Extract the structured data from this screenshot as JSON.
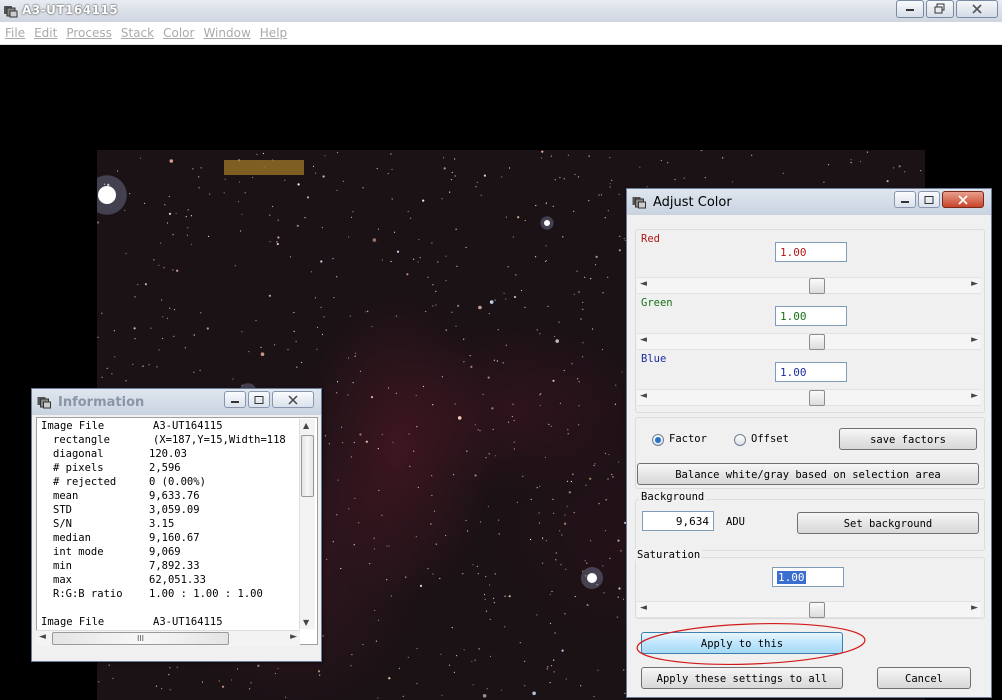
{
  "window": {
    "title": "A3-UT164115"
  },
  "menu": [
    "File",
    "Edit",
    "Process",
    "Stack",
    "Color",
    "Window",
    "Help"
  ],
  "info": {
    "title": "Information",
    "rows": [
      {
        "k": "Image File",
        "v": "A3-UT164115"
      },
      {
        "k": "rectangle",
        "v": "(X=187,Y=15,Width=118"
      },
      {
        "k": "diagonal",
        "v": "120.03"
      },
      {
        "k": "# pixels",
        "v": "2,596"
      },
      {
        "k": "# rejected",
        "v": "0 (0.00%)"
      },
      {
        "k": "mean",
        "v": "9,633.76"
      },
      {
        "k": "STD",
        "v": "3,059.09"
      },
      {
        "k": "S/N",
        "v": "3.15"
      },
      {
        "k": "median",
        "v": "9,160.67"
      },
      {
        "k": "int mode",
        "v": "9,069"
      },
      {
        "k": "min",
        "v": "7,892.33"
      },
      {
        "k": "max",
        "v": "62,051.33"
      },
      {
        "k": "R:G:B ratio",
        "v": "1.00 : 1.00 : 1.00"
      },
      {
        "k": "",
        "v": ""
      },
      {
        "k": "Image File",
        "v": "A3-UT164115"
      }
    ],
    "hscroll_grip": "III"
  },
  "adjust": {
    "title": "Adjust Color",
    "red": {
      "label": "Red",
      "value": "1.00",
      "color": "#b01818"
    },
    "green": {
      "label": "Green",
      "value": "1.00",
      "color": "#147214"
    },
    "blue": {
      "label": "Blue",
      "value": "1.00",
      "color": "#1c2a9e"
    },
    "factor_label": "Factor",
    "offset_label": "Offset",
    "mode_selected": "Factor",
    "save_factors": "save factors",
    "balance": "Balance white/gray based on selection area",
    "background_label": "Background",
    "background_value": "9,634",
    "background_unit": "ADU",
    "set_background": "Set background",
    "saturation_label": "Saturation",
    "saturation_value": "1.00",
    "apply_this": "Apply to this",
    "apply_all": "Apply these settings to all",
    "cancel": "Cancel"
  }
}
